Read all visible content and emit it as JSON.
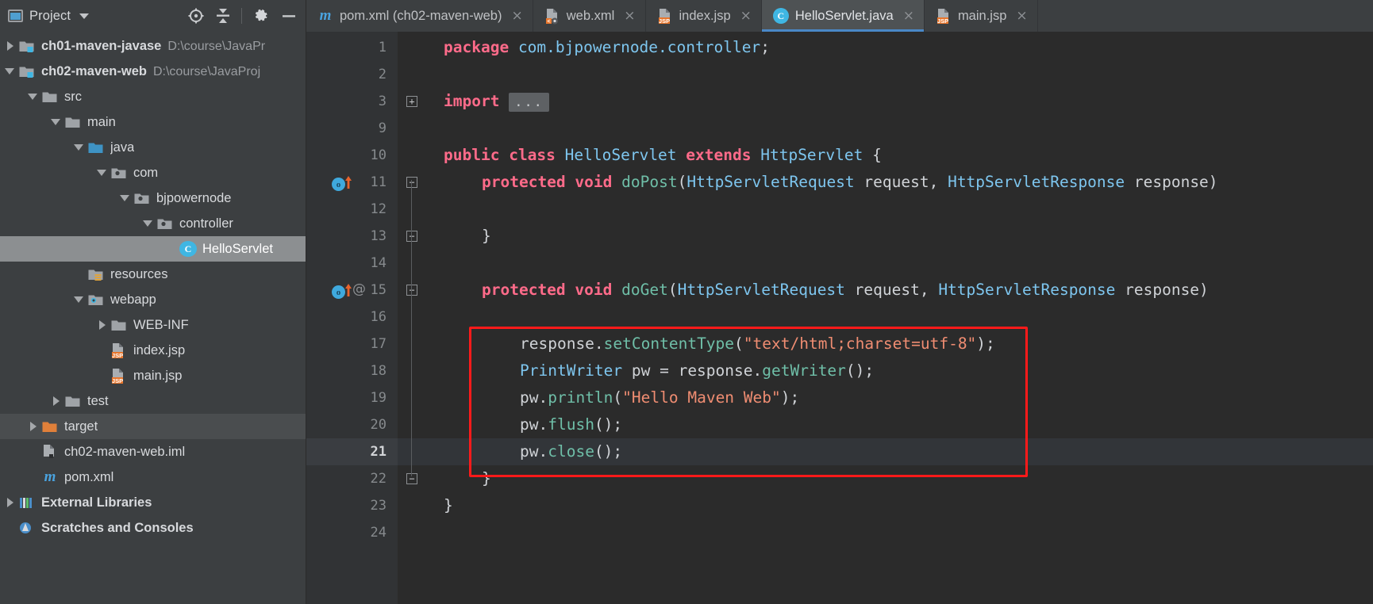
{
  "project_panel": {
    "title": "Project",
    "icons": [
      "project-window-icon",
      "chevron-down-icon",
      "locate-file-icon",
      "collapse-all-icon",
      "gear-icon",
      "minimize-icon"
    ],
    "tree": [
      {
        "indent": 0,
        "arrow": "closed",
        "icon": "module-folder-icon",
        "label": "ch01-maven-javase",
        "path": "D:\\course\\JavaPr",
        "state": "normal"
      },
      {
        "indent": 0,
        "arrow": "open",
        "icon": "module-folder-icon",
        "label": "ch02-maven-web",
        "path": "D:\\course\\JavaProj",
        "state": "normal"
      },
      {
        "indent": 1,
        "arrow": "open",
        "icon": "folder-icon",
        "label": "src",
        "path": "",
        "state": "normal"
      },
      {
        "indent": 2,
        "arrow": "open",
        "icon": "folder-icon",
        "label": "main",
        "path": "",
        "state": "normal"
      },
      {
        "indent": 3,
        "arrow": "open",
        "icon": "source-root-icon",
        "label": "java",
        "path": "",
        "state": "normal"
      },
      {
        "indent": 4,
        "arrow": "open",
        "icon": "package-icon",
        "label": "com",
        "path": "",
        "state": "normal"
      },
      {
        "indent": 5,
        "arrow": "open",
        "icon": "package-icon",
        "label": "bjpowernode",
        "path": "",
        "state": "normal"
      },
      {
        "indent": 6,
        "arrow": "open",
        "icon": "package-icon",
        "label": "controller",
        "path": "",
        "state": "normal"
      },
      {
        "indent": 7,
        "arrow": "none",
        "icon": "java-class-icon",
        "label": "HelloServlet",
        "path": "",
        "state": "selected"
      },
      {
        "indent": 3,
        "arrow": "none",
        "icon": "resources-root-icon",
        "label": "resources",
        "path": "",
        "state": "normal"
      },
      {
        "indent": 3,
        "arrow": "open",
        "icon": "webapp-root-icon",
        "label": "webapp",
        "path": "",
        "state": "normal"
      },
      {
        "indent": 4,
        "arrow": "closed",
        "icon": "folder-icon",
        "label": "WEB-INF",
        "path": "",
        "state": "normal"
      },
      {
        "indent": 4,
        "arrow": "none",
        "icon": "jsp-file-icon",
        "label": "index.jsp",
        "path": "",
        "state": "normal"
      },
      {
        "indent": 4,
        "arrow": "none",
        "icon": "jsp-file-icon",
        "label": "main.jsp",
        "path": "",
        "state": "normal"
      },
      {
        "indent": 2,
        "arrow": "closed",
        "icon": "folder-icon",
        "label": "test",
        "path": "",
        "state": "normal"
      },
      {
        "indent": 1,
        "arrow": "closed",
        "icon": "excluded-folder-icon",
        "label": "target",
        "path": "",
        "state": "highlight"
      },
      {
        "indent": 1,
        "arrow": "none",
        "icon": "iml-file-icon",
        "label": "ch02-maven-web.iml",
        "path": "",
        "state": "normal"
      },
      {
        "indent": 1,
        "arrow": "none",
        "icon": "maven-file-icon",
        "label": "pom.xml",
        "path": "",
        "state": "normal"
      },
      {
        "indent": 0,
        "arrow": "closed",
        "icon": "libraries-icon",
        "label": "External Libraries",
        "path": "",
        "state": "normal"
      },
      {
        "indent": 0,
        "arrow": "none",
        "icon": "scratches-icon",
        "label": "Scratches and Consoles",
        "path": "",
        "state": "normal"
      }
    ]
  },
  "tabs": [
    {
      "label": "pom.xml (ch02-maven-web)",
      "icon": "maven-file-icon",
      "active": false,
      "close": "×"
    },
    {
      "label": "web.xml",
      "icon": "xml-config-file-icon",
      "active": false,
      "close": "×"
    },
    {
      "label": "index.jsp",
      "icon": "jsp-file-icon",
      "active": false,
      "close": "×"
    },
    {
      "label": "HelloServlet.java",
      "icon": "java-class-icon",
      "active": true,
      "close": "×"
    },
    {
      "label": "main.jsp",
      "icon": "jsp-file-icon",
      "active": false,
      "close": "×"
    }
  ],
  "editor": {
    "current_line": 21,
    "import_fold_placeholder": "...",
    "line_numbers": [
      "1",
      "2",
      "3",
      "9",
      "10",
      "11",
      "12",
      "13",
      "14",
      "15",
      "16",
      "17",
      "18",
      "19",
      "20",
      "21",
      "22",
      "23",
      "24"
    ],
    "lines": [
      {
        "num": "1",
        "indent": 0,
        "tokens": [
          {
            "t": "package",
            "c": "kw2"
          },
          {
            "t": " ",
            "c": "pln"
          },
          {
            "t": "com.bjpowernode.controller",
            "c": "typ"
          },
          {
            "t": ";",
            "c": "pln"
          }
        ]
      },
      {
        "num": "2",
        "indent": 0,
        "tokens": []
      },
      {
        "num": "3",
        "indent": 0,
        "tokens": [
          {
            "t": "import",
            "c": "kw2"
          },
          {
            "t": " ",
            "c": "pln"
          }
        ],
        "fold": true
      },
      {
        "num": "9",
        "indent": 0,
        "tokens": []
      },
      {
        "num": "10",
        "indent": 0,
        "tokens": [
          {
            "t": "public",
            "c": "kw2"
          },
          {
            "t": " ",
            "c": "pln"
          },
          {
            "t": "class",
            "c": "kw2"
          },
          {
            "t": " ",
            "c": "pln"
          },
          {
            "t": "HelloServlet",
            "c": "typ"
          },
          {
            "t": " ",
            "c": "pln"
          },
          {
            "t": "extends",
            "c": "kw2"
          },
          {
            "t": " ",
            "c": "pln"
          },
          {
            "t": "HttpServlet",
            "c": "typ"
          },
          {
            "t": " {",
            "c": "pln"
          }
        ]
      },
      {
        "num": "11",
        "indent": 1,
        "tokens": [
          {
            "t": "protected",
            "c": "kw2"
          },
          {
            "t": " ",
            "c": "pln"
          },
          {
            "t": "void",
            "c": "kw2"
          },
          {
            "t": " ",
            "c": "pln"
          },
          {
            "t": "doPost",
            "c": "mth"
          },
          {
            "t": "(",
            "c": "pln"
          },
          {
            "t": "HttpServletRequest",
            "c": "typ"
          },
          {
            "t": " request, ",
            "c": "pln"
          },
          {
            "t": "HttpServletResponse",
            "c": "typ"
          },
          {
            "t": " response)",
            "c": "pln"
          }
        ]
      },
      {
        "num": "12",
        "indent": 0,
        "tokens": []
      },
      {
        "num": "13",
        "indent": 1,
        "tokens": [
          {
            "t": "}",
            "c": "pln"
          }
        ]
      },
      {
        "num": "14",
        "indent": 0,
        "tokens": []
      },
      {
        "num": "15",
        "indent": 1,
        "tokens": [
          {
            "t": "protected",
            "c": "kw2"
          },
          {
            "t": " ",
            "c": "pln"
          },
          {
            "t": "void",
            "c": "kw2"
          },
          {
            "t": " ",
            "c": "pln"
          },
          {
            "t": "doGet",
            "c": "mth"
          },
          {
            "t": "(",
            "c": "pln"
          },
          {
            "t": "HttpServletRequest",
            "c": "typ"
          },
          {
            "t": " request, ",
            "c": "pln"
          },
          {
            "t": "HttpServletResponse",
            "c": "typ"
          },
          {
            "t": " response)",
            "c": "pln"
          }
        ]
      },
      {
        "num": "16",
        "indent": 0,
        "tokens": []
      },
      {
        "num": "17",
        "indent": 2,
        "tokens": [
          {
            "t": "response.",
            "c": "pln"
          },
          {
            "t": "setContentType",
            "c": "mth"
          },
          {
            "t": "(",
            "c": "pln"
          },
          {
            "t": "\"text/html;charset=utf-8\"",
            "c": "str"
          },
          {
            "t": ");",
            "c": "pln"
          }
        ]
      },
      {
        "num": "18",
        "indent": 2,
        "tokens": [
          {
            "t": "PrintWriter",
            "c": "typ"
          },
          {
            "t": " pw = response.",
            "c": "pln"
          },
          {
            "t": "getWriter",
            "c": "mth"
          },
          {
            "t": "();",
            "c": "pln"
          }
        ]
      },
      {
        "num": "19",
        "indent": 2,
        "tokens": [
          {
            "t": "pw.",
            "c": "pln"
          },
          {
            "t": "println",
            "c": "mth"
          },
          {
            "t": "(",
            "c": "pln"
          },
          {
            "t": "\"Hello Maven Web\"",
            "c": "str"
          },
          {
            "t": ");",
            "c": "pln"
          }
        ]
      },
      {
        "num": "20",
        "indent": 2,
        "tokens": [
          {
            "t": "pw.",
            "c": "pln"
          },
          {
            "t": "flush",
            "c": "mth"
          },
          {
            "t": "();",
            "c": "pln"
          }
        ]
      },
      {
        "num": "21",
        "indent": 2,
        "tokens": [
          {
            "t": "pw.",
            "c": "pln"
          },
          {
            "t": "close",
            "c": "mth"
          },
          {
            "t": "();",
            "c": "pln"
          }
        ]
      },
      {
        "num": "22",
        "indent": 1,
        "tokens": [
          {
            "t": "}",
            "c": "pln"
          }
        ]
      },
      {
        "num": "23",
        "indent": 0,
        "tokens": [
          {
            "t": "}",
            "c": "pln"
          }
        ]
      },
      {
        "num": "24",
        "indent": 0,
        "tokens": []
      }
    ],
    "gutter_markers": [
      {
        "line": "11",
        "icon": "override-method-icon"
      },
      {
        "line": "15",
        "icon": "override-method-icon"
      },
      {
        "line": "15",
        "icon": "annotation-at-icon",
        "glyph": "@"
      }
    ],
    "annotation": {
      "name": "red-highlight-rectangle",
      "color": "#ff1a1a"
    }
  },
  "colors": {
    "editor_bg": "#2b2b2b",
    "gutter_bg": "#313335",
    "panel_bg": "#3c3f41",
    "selection": "#8c8f91",
    "accent_blue": "#4a88c7",
    "keyword_pink": "#ff6b8a",
    "type_blue": "#7ec6ef",
    "method_teal": "#6fbfa8",
    "string_orange": "#f08d72",
    "annotation_red": "#ff1a1a"
  }
}
